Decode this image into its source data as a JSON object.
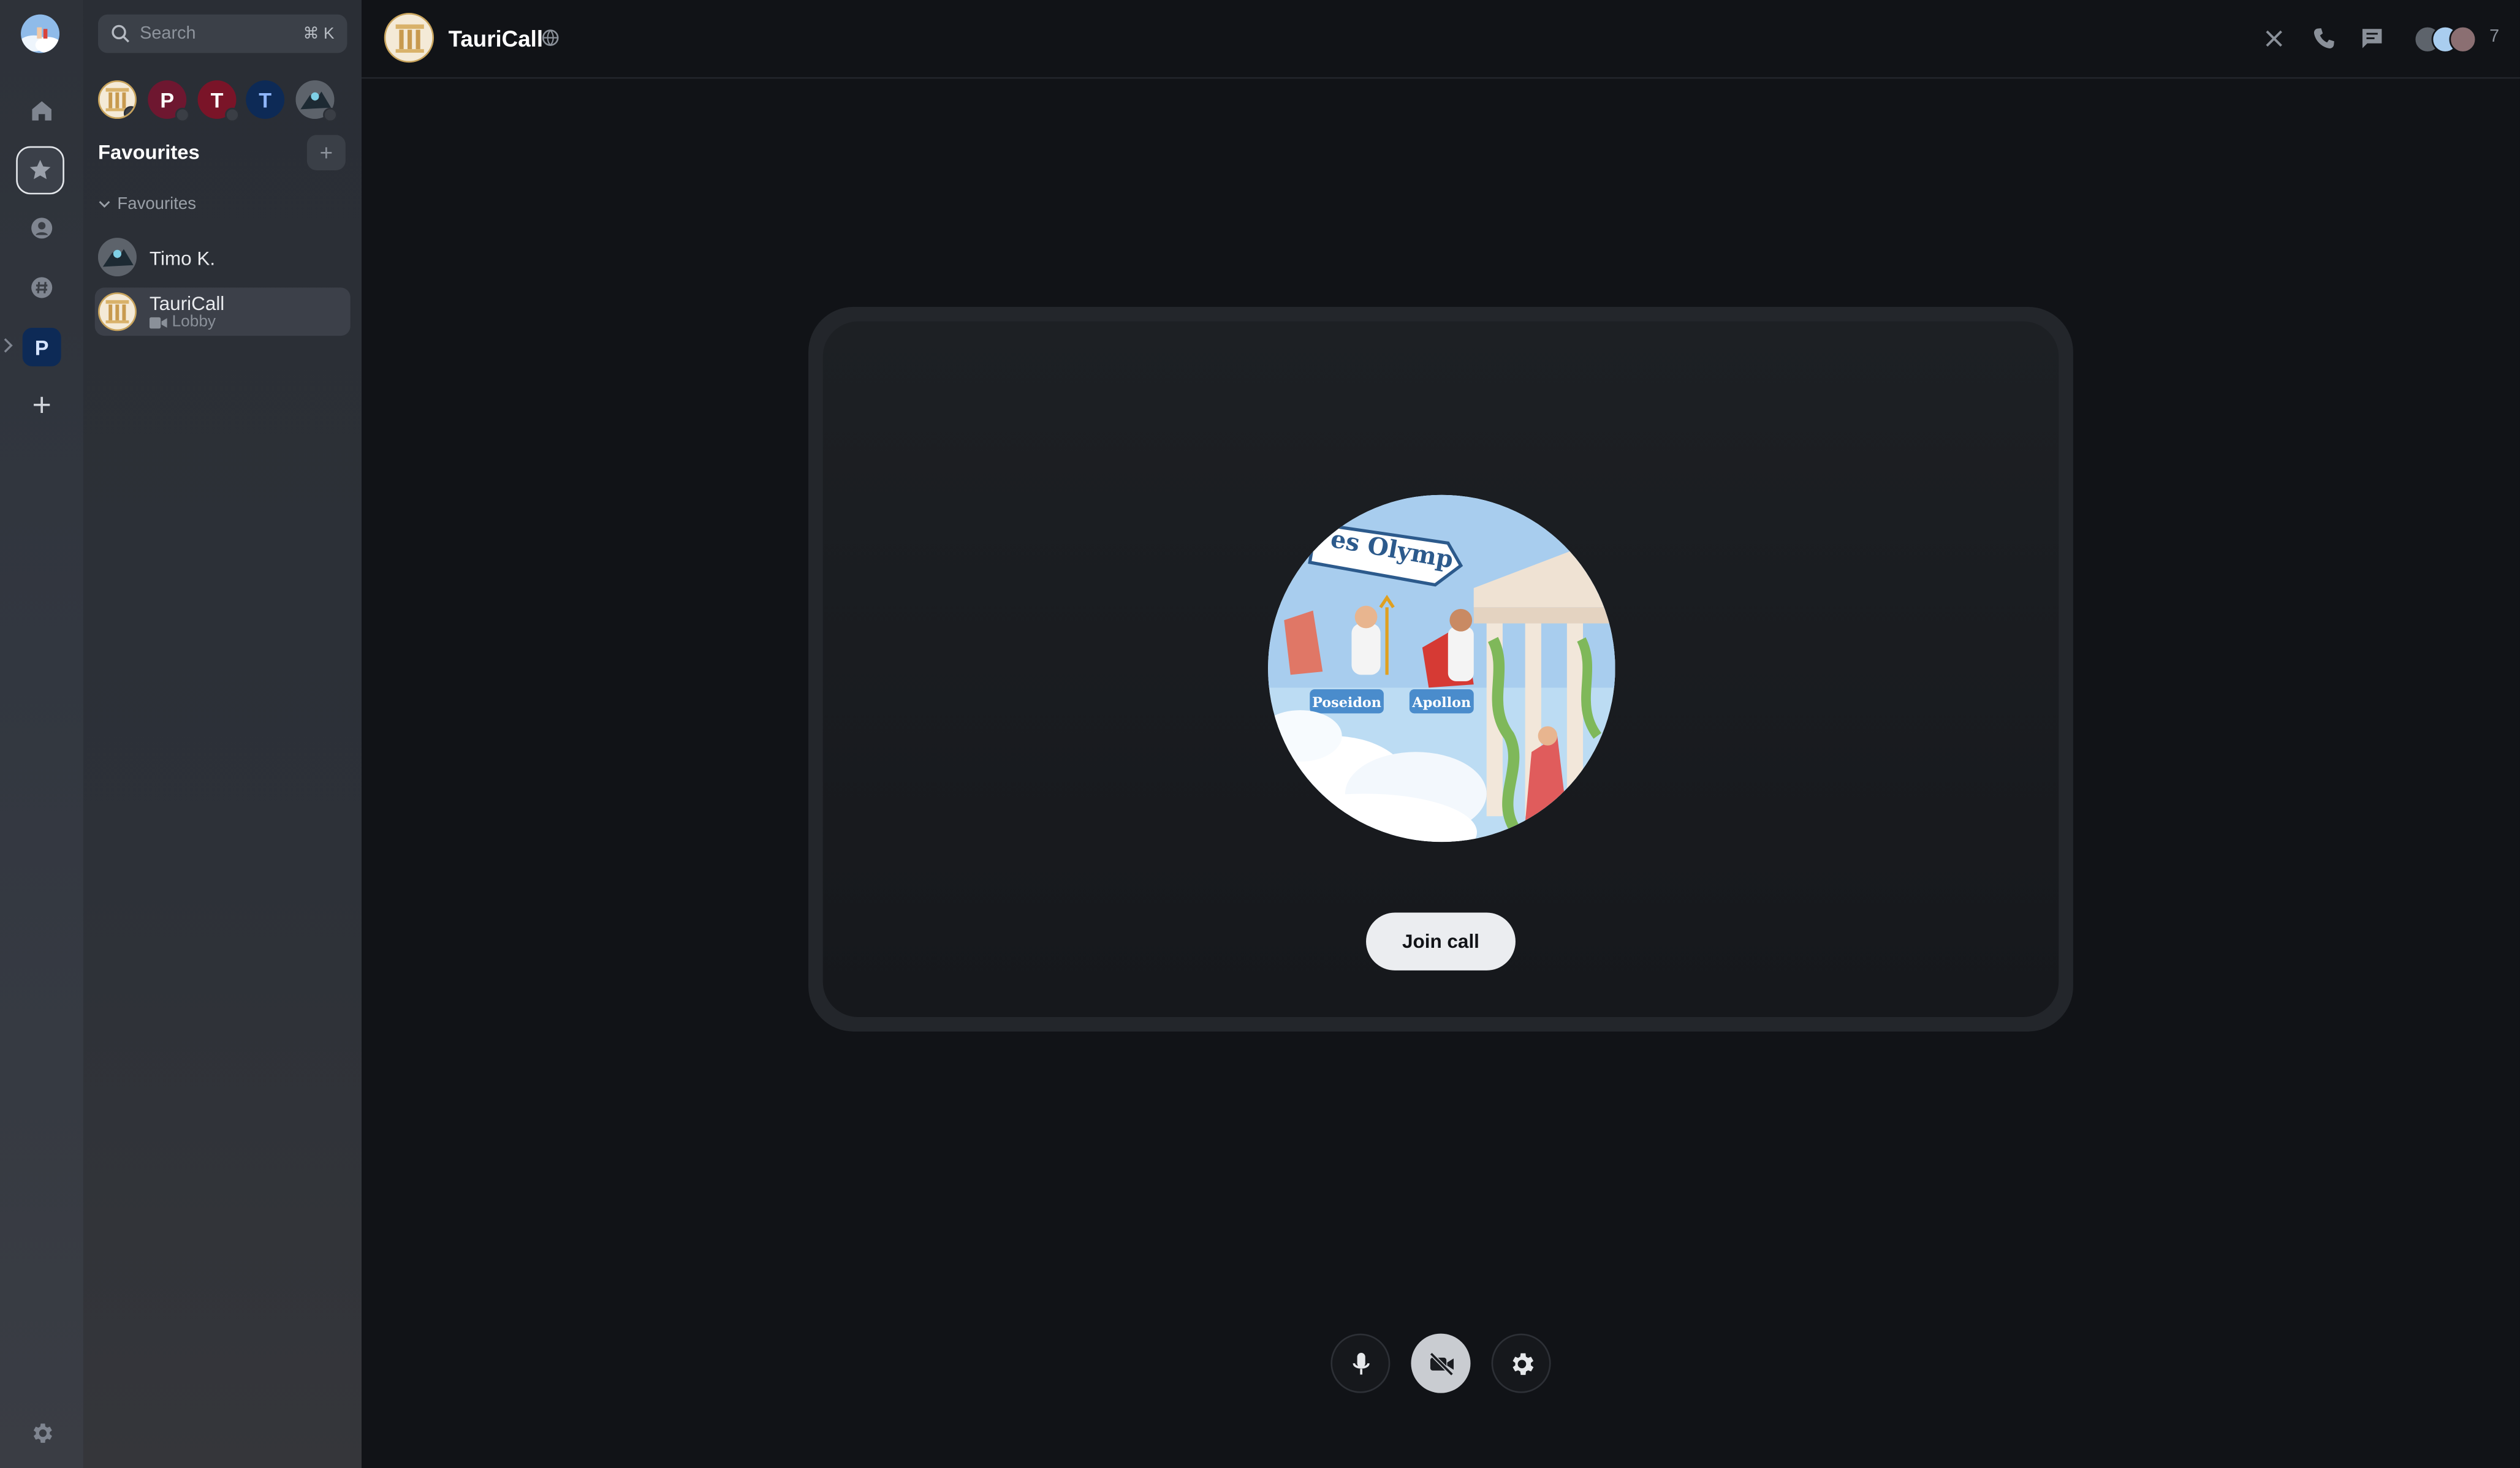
{
  "sidebar": {
    "search_placeholder": "Search",
    "search_shortcut": "⌘ K",
    "favourites_title": "Favourites",
    "favourites_add": "+",
    "section_label": "Favourites",
    "people": [
      {
        "initial": "",
        "kind": "tauricall"
      },
      {
        "initial": "P",
        "color": "#6e1730"
      },
      {
        "initial": "T",
        "color": "#7a1428"
      },
      {
        "initial": "T",
        "color": "#0d2a56"
      },
      {
        "initial": "",
        "kind": "photo"
      }
    ],
    "rooms": [
      {
        "name": "Timo K.",
        "subtitle": ""
      },
      {
        "name": "TauriCall",
        "subtitle": "Lobby"
      }
    ]
  },
  "rail": {
    "active_space_initial": "P"
  },
  "header": {
    "room_name": "TauriCall",
    "member_count": "7"
  },
  "call": {
    "join_label": "Join call",
    "banner_text": "es Olymp",
    "label_left": "Poseidon",
    "label_right": "Apollon"
  },
  "colors": {
    "accent_space": "#0d2a56",
    "background": "#111317",
    "join_button": "#ebedf0"
  },
  "icons": [
    "home-icon",
    "star-icon",
    "person-icon",
    "hash-icon",
    "plus-icon",
    "settings-icon",
    "search-icon",
    "close-icon",
    "phone-icon",
    "chat-icon",
    "microphone-icon",
    "video-off-icon",
    "gear-icon",
    "globe-icon",
    "video-icon"
  ]
}
